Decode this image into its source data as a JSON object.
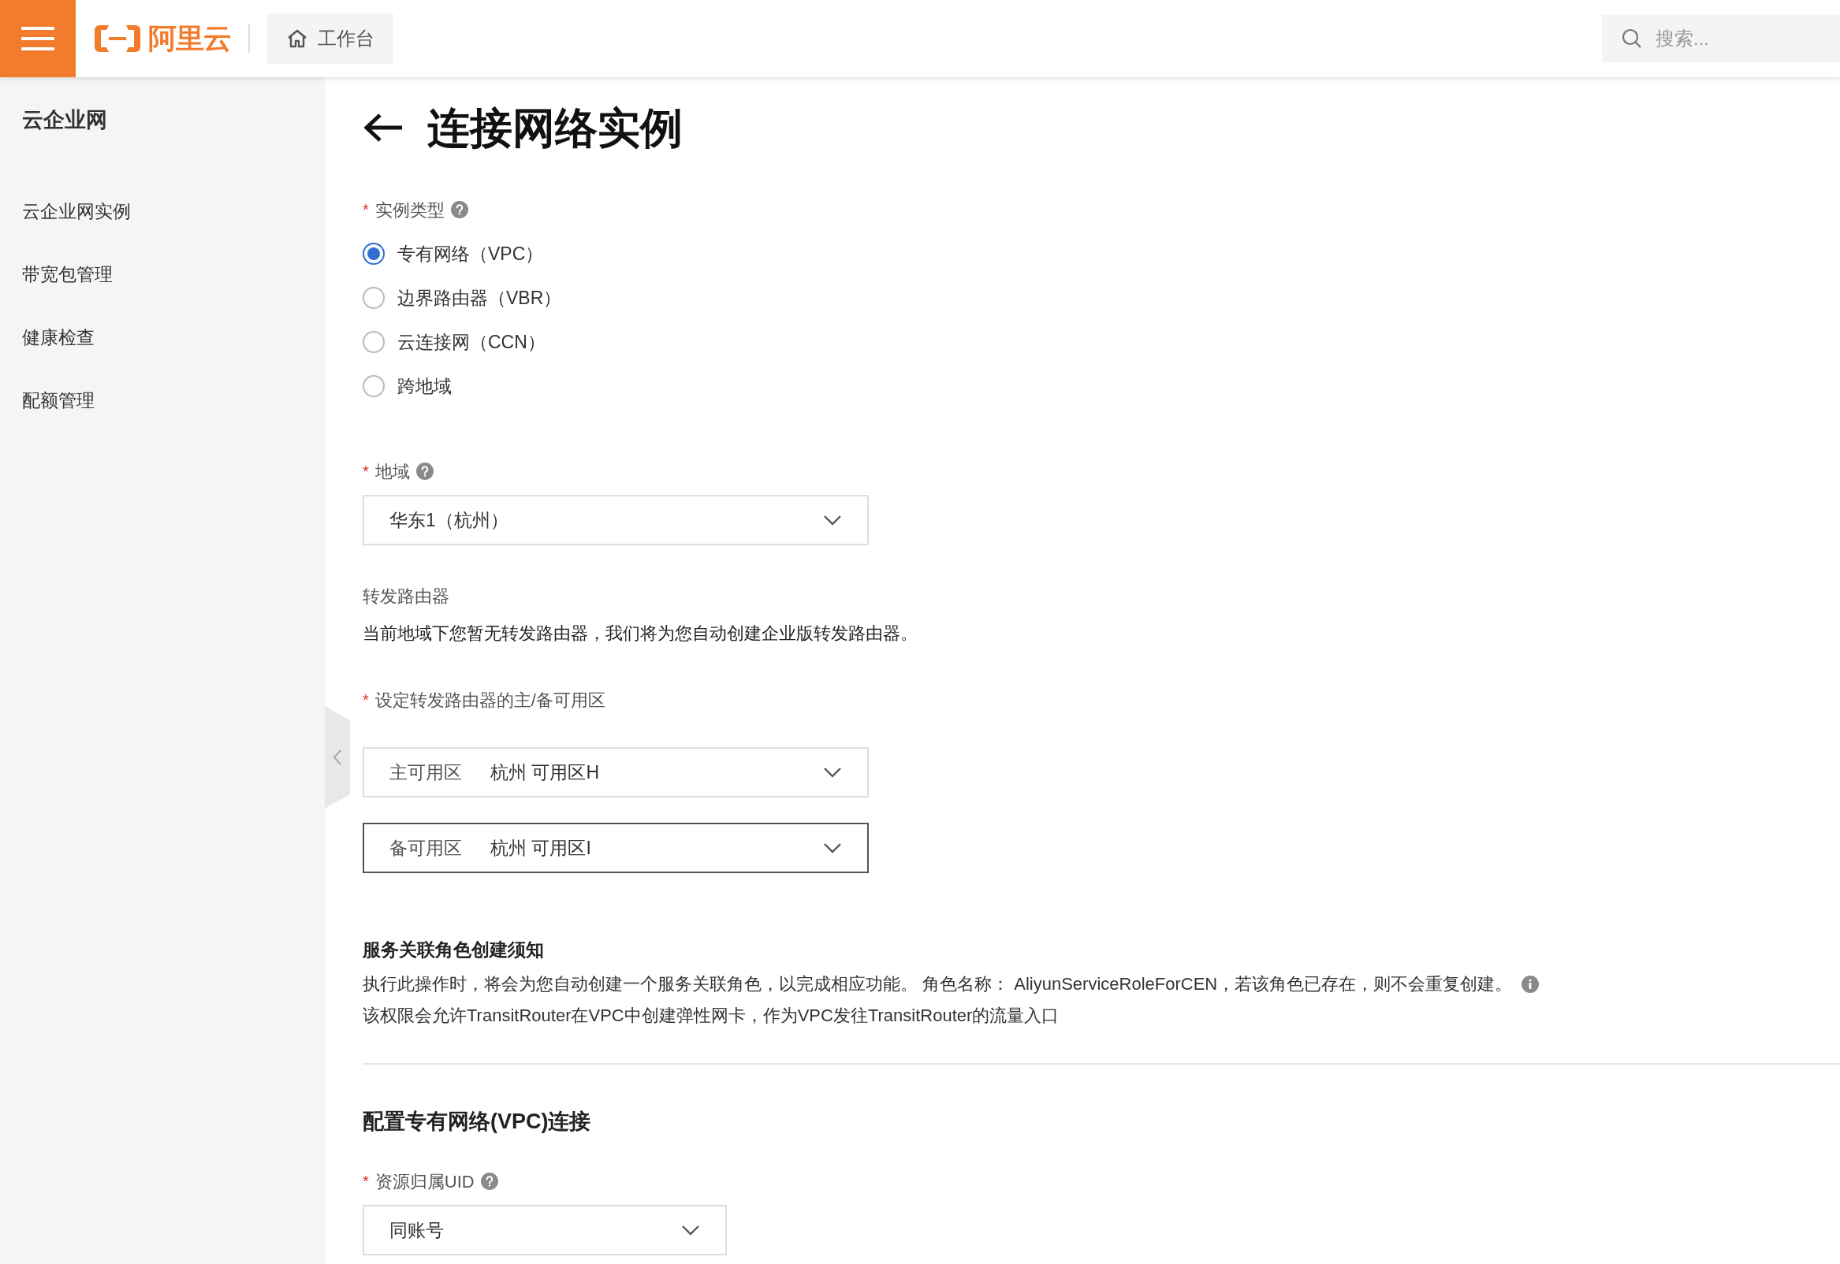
{
  "header": {
    "logo_text": "阿里云",
    "workbench": "工作台",
    "search": {
      "placeholder": "搜索..."
    }
  },
  "sidebar": {
    "title": "云企业网",
    "items": [
      {
        "label": "云企业网实例"
      },
      {
        "label": "带宽包管理"
      },
      {
        "label": "健康检查"
      },
      {
        "label": "配额管理"
      }
    ]
  },
  "page": {
    "title": "连接网络实例"
  },
  "instance_type": {
    "marker": "*",
    "label": "实例类型",
    "help": true,
    "options": [
      {
        "label": "专有网络（VPC）",
        "selected": true
      },
      {
        "label": "边界路由器（VBR）",
        "selected": false
      },
      {
        "label": "云连接网（CCN）",
        "selected": false
      },
      {
        "label": "跨地域",
        "selected": false
      }
    ]
  },
  "region": {
    "marker": "*",
    "label": "地域",
    "help": true,
    "value": "华东1（杭州）"
  },
  "transit_router": {
    "label": "转发路由器",
    "note": "当前地域下您暂无转发路由器，我们将为您自动创建企业版转发路由器。"
  },
  "zones": {
    "marker": "*",
    "label": "设定转发路由器的主/备可用区",
    "selects": [
      {
        "prefix": "主可用区",
        "value": "杭州 可用区H",
        "focused": false
      },
      {
        "prefix": "备可用区",
        "value": "杭州 可用区I",
        "focused": true
      }
    ]
  },
  "notice": {
    "title": "服务关联角色创建须知",
    "lines": [
      {
        "text": "执行此操作时，将会为您自动创建一个服务关联角色，以完成相应功能。 角色名称： AliyunServiceRoleForCEN，若该角色已存在，则不会重复创建。",
        "info": true
      },
      {
        "text": "该权限会允许TransitRouter在VPC中创建弹性网卡，作为VPC发往TransitRouter的流量入口",
        "info": false
      }
    ]
  },
  "vpc_section": {
    "title": "配置专有网络(VPC)连接",
    "uid": {
      "marker": "*",
      "label": "资源归属UID",
      "help": true,
      "value": "同账号"
    }
  }
}
